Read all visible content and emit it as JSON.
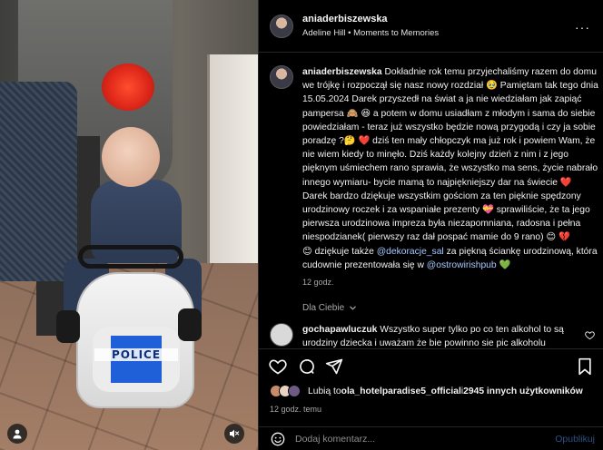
{
  "post": {
    "username": "aniaderbiszewska",
    "location": "Adeline Hill • Moments to Memories",
    "more_icon": "more-horizontal-icon"
  },
  "photo": {
    "car_label": "POLICE",
    "user_icon": "person-icon",
    "mute_icon": "speaker-muted-icon"
  },
  "caption": {
    "username": "aniaderbiszewska",
    "p1": "Dokładnie rok temu przyjechaliśmy razem do domu we trójkę i rozpoczął się nasz nowy rozdział 🥹 Pamiętam tak tego dnia 15.05.2024 Darek przyszedł na świat a ja nie wiedziałam jak zapiąć pampersa 🙈 😆 a potem w domu usiadłam z młodym i sama do siebie powiedziałam - teraz już wszystko będzie nową przygodą i czy ja sobie poradzę ?🤔 ❤️ dziś ten mały chłopczyk ma już rok i powiem Wam, że nie wiem kiedy to minęło. Dziś każdy kolejny dzień z nim i z jego pięknym uśmiechem rano sprawia, że wszystko ma sens, życie nabrało innego wymiaru- bycie mamą to najpiękniejszy dar na świecie ❤️",
    "p2_a": "Darek bardzo dziękuje wszystkim gościom za ten pięknie spędzony urodzinowy roczek i za wspaniałe prezenty 💝 sprawiliście, że ta jego pierwsza urodzinowa impreza była niezapomniana, radosna i pełna niespodzianek( pierwszy raz dał pospać mamie do 9 rano) 😊 💔",
    "p2_b": "😊 dziękuje także ",
    "tag1": "@dekoracje_sal",
    "p2_c": " za piękną ściankę urodzinową, która cudownie prezentowała się w ",
    "tag2": "@ostrowirishpub",
    "p2_d": " 💚",
    "time": "12 godz."
  },
  "translate": {
    "label": "Dla Ciebie",
    "chevron_icon": "chevron-down-icon"
  },
  "comment": {
    "username": "gochapawluczuk",
    "text": "Wszystko super tylko po co ten alkohol to są urodziny dziecka i uważam że bie powinno sie pic alkoholu",
    "heart_icon": "heart-icon"
  },
  "actions": {
    "like_icon": "heart-icon",
    "comment_icon": "comment-bubble-icon",
    "share_icon": "send-paper-plane-icon",
    "save_icon": "bookmark-icon"
  },
  "likes": {
    "prefix": "Lubią to ",
    "user": "ola_hotelparadise5_official",
    "middle": " i ",
    "others": "2945 innych użytkowników"
  },
  "ago": "12 godz. temu",
  "composer": {
    "emoji_icon": "smiley-icon",
    "placeholder": "Dodaj komentarz...",
    "post_label": "Opublikuj"
  },
  "colors": {
    "background": "#000000",
    "text": "#f5f5f5",
    "muted": "#a8a8a8",
    "link": "#a7c8ff",
    "post_disabled": "#2c4f86"
  }
}
